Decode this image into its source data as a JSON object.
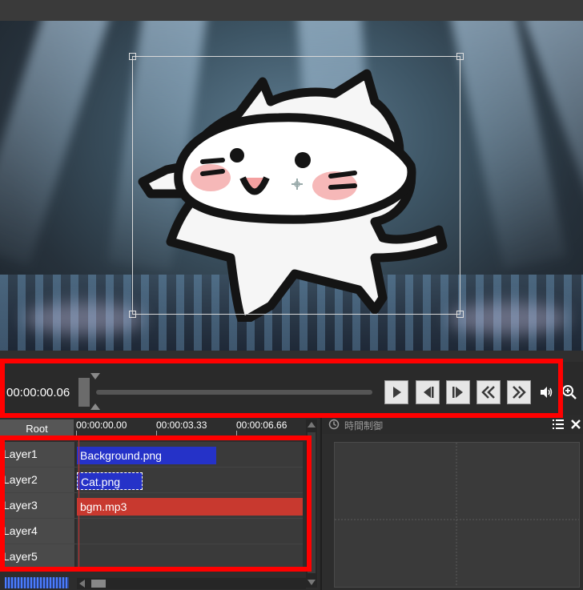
{
  "transport": {
    "current_time": "00:00:00.06",
    "buttons": [
      "play",
      "step-back",
      "step-forward",
      "rewind",
      "fast-forward"
    ]
  },
  "timeline": {
    "root_label": "Root",
    "ruler_ticks": [
      "00:00:00.00",
      "00:00:03.33",
      "00:00:06.66"
    ],
    "layers": [
      {
        "name": "Layer1",
        "clip": "Background.png",
        "clip_color": "#2532c8"
      },
      {
        "name": "Layer2",
        "clip": "Cat.png",
        "clip_color": "#2532c8"
      },
      {
        "name": "Layer3",
        "clip": "bgm.mp3",
        "clip_color": "#c8392f"
      },
      {
        "name": "Layer4",
        "clip": ""
      },
      {
        "name": "Layer5",
        "clip": ""
      }
    ]
  },
  "side_panel": {
    "title": "時間制御"
  },
  "icons": {
    "volume": "volume-icon",
    "zoom": "zoom-in-icon",
    "list": "list-icon",
    "close": "close-icon",
    "clock": "clock-icon"
  },
  "colors": {
    "highlight_frame": "#ff0000"
  }
}
